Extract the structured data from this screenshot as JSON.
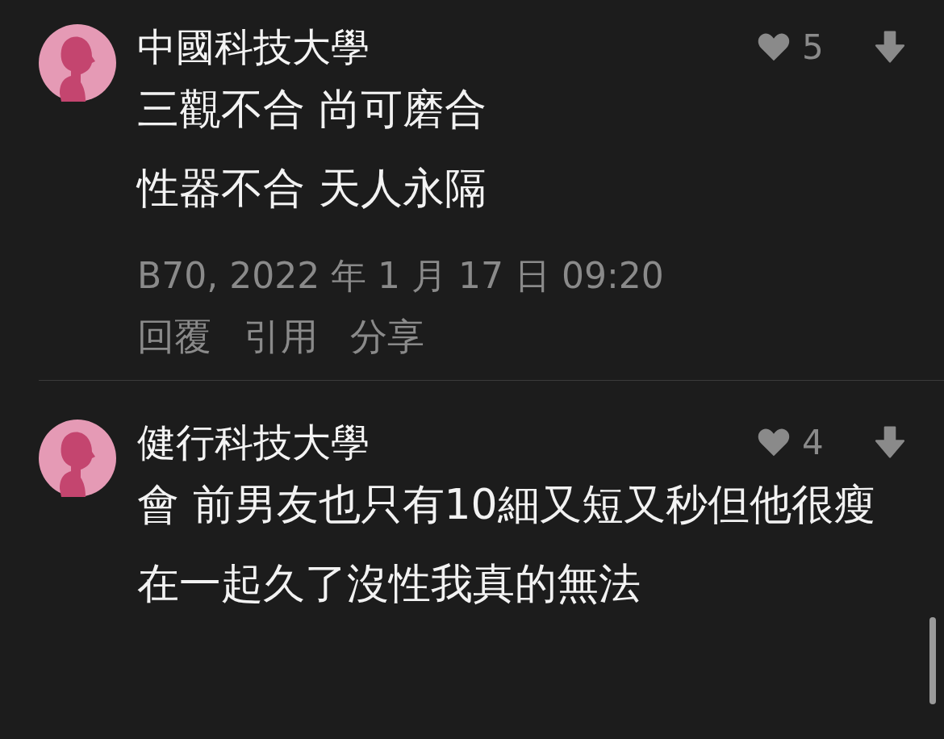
{
  "comments": [
    {
      "author": "中國科技大學",
      "likes": "5",
      "body": [
        "三觀不合 尚可磨合",
        "性器不合 天人永隔"
      ],
      "meta": "B70, 2022 年 1 月 17 日 09:20",
      "actions": [
        "回覆",
        "引用",
        "分享"
      ]
    },
    {
      "author": "健行科技大學",
      "likes": "4",
      "body": [
        "會 前男友也只有10細又短又秒但他很瘦",
        "在一起久了沒性我真的無法"
      ]
    }
  ]
}
